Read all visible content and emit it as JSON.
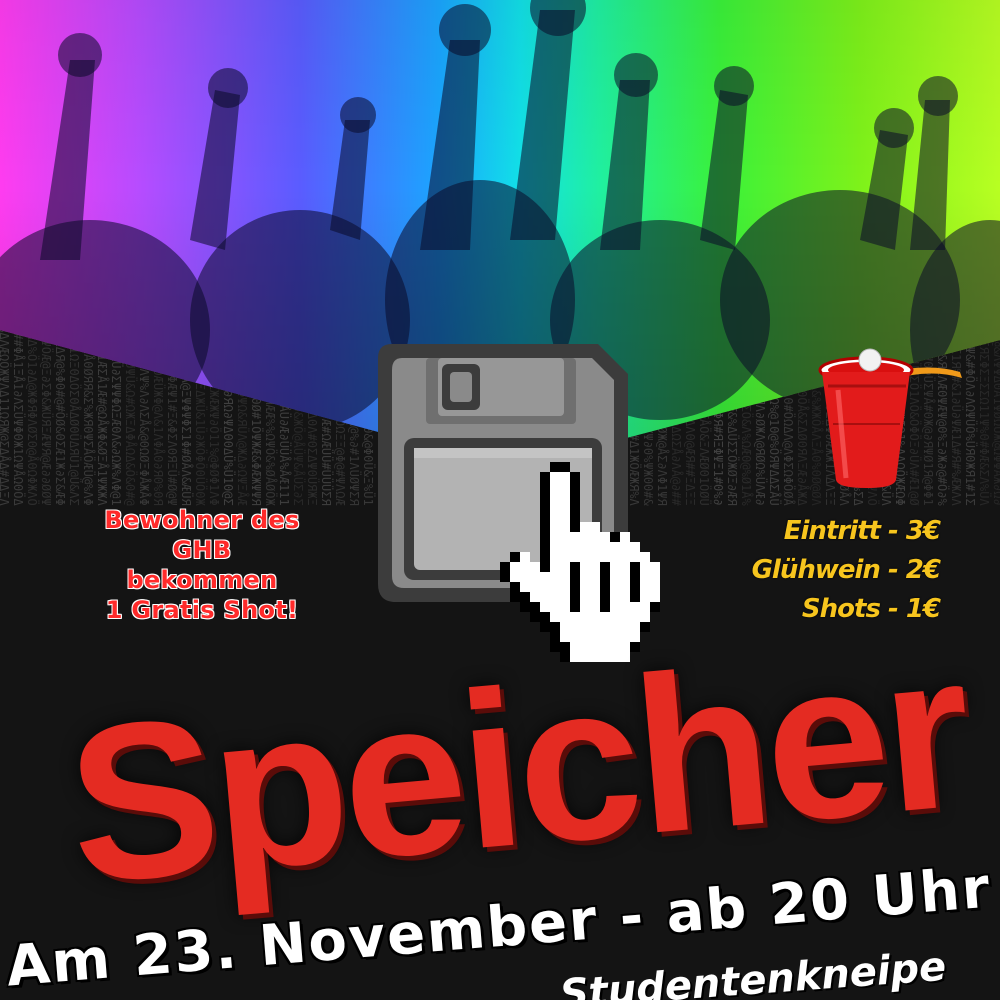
{
  "poster": {
    "title": "Speicher",
    "date_line": "Am 23. November - ab 20 Uhr",
    "footer_partial": "Studentenkneipe"
  },
  "resident_note": {
    "lines": [
      "Bewohner des",
      "GHB",
      "bekommen",
      "1 Gratis Shot!"
    ]
  },
  "prices": [
    {
      "text": "Eintritt - 3€"
    },
    {
      "text": "Glühwein - 2€"
    },
    {
      "text": "Shots - 1€"
    }
  ],
  "colors": {
    "title": "#e42b22",
    "note": "#ff2a2a",
    "prices": "#f7c51e",
    "background": "#141414"
  },
  "icons": [
    "floppy-disk-icon",
    "hand-pointer-cursor-icon",
    "red-cup-icon"
  ]
}
